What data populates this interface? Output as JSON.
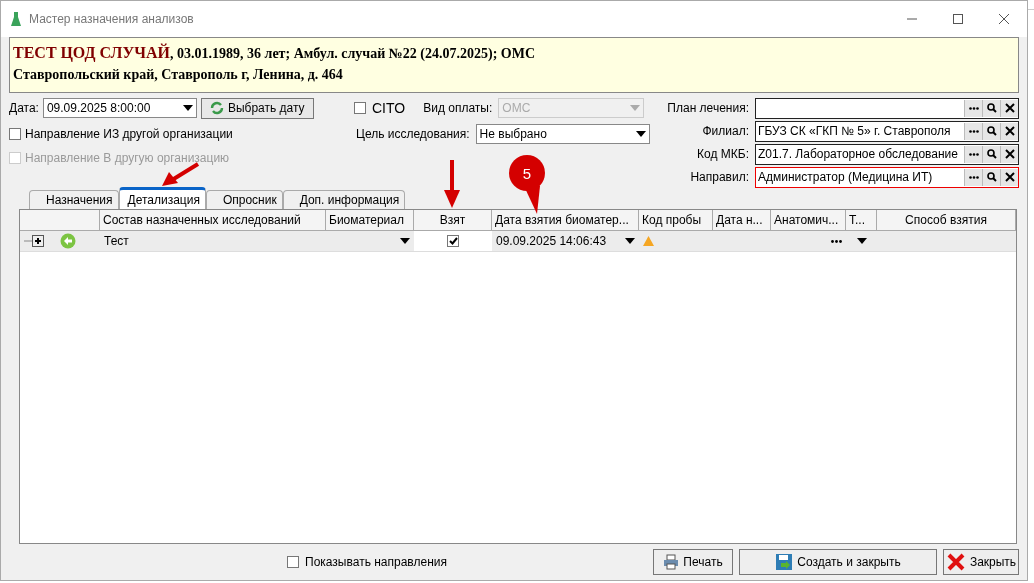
{
  "window": {
    "title": "Мастер назначения анализов"
  },
  "patient": {
    "name": "ТЕСТ ЦОД СЛУЧАЙ",
    "details": ", 03.01.1989, 36 лет; Амбул. случай №22 (24.07.2025); ОМС",
    "address": "Ставропольский край, Ставрополь г, Ленина, д. 464"
  },
  "form": {
    "date": {
      "label": "Дата:",
      "value": "09.09.2025 8:00:00"
    },
    "pick_date_button": "Выбрать дату",
    "cito": {
      "label": "CITO",
      "checked": false
    },
    "payment": {
      "label": "Вид оплаты:",
      "value": "ОМС",
      "disabled": true
    },
    "purpose": {
      "label": "Цель исследования:",
      "value": "Не выбрано",
      "disabled": false
    },
    "from_org": {
      "label": "Направление ИЗ другой организации",
      "checked": false,
      "disabled": false
    },
    "to_org": {
      "label": "Направление В другую организацию",
      "checked": false,
      "disabled": true
    }
  },
  "lookups": [
    {
      "label": "План лечения:",
      "highlighted": false
    },
    {
      "label": "Филиал:",
      "value": "ГБУЗ СК «ГКП № 5» г. Ставрополя",
      "highlighted": false
    },
    {
      "label": "Код МКБ:",
      "value": "Z01.7. Лабораторное обследование",
      "highlighted": false
    },
    {
      "label": "Направил:",
      "value": "Администратор (Медицина ИТ)",
      "highlighted": true
    }
  ],
  "tabs": [
    {
      "label": "Назначения",
      "selected": false
    },
    {
      "label": "Детализация",
      "selected": true
    },
    {
      "label": "Опросник",
      "selected": false
    },
    {
      "label": "Доп. информация",
      "selected": false
    }
  ],
  "table": {
    "columns": [
      "Состав назначенных исследований",
      "Биоматериал",
      "Взят",
      "Дата взятия биоматер...",
      "Код пробы",
      "Дата н...",
      "Анатомич...",
      "Т...",
      "Способ взятия"
    ],
    "rows": [
      {
        "expanded": false,
        "name": "Тест",
        "taken": true,
        "date": "09.09.2025 14:06:43",
        "warning": true
      }
    ]
  },
  "footer": {
    "show_directions": {
      "label": "Показывать направления",
      "checked": false
    },
    "buttons": [
      {
        "label": "Печать",
        "kind": "print"
      },
      {
        "label": "Создать и закрыть",
        "kind": "save"
      },
      {
        "label": "Закрыть",
        "kind": "close"
      }
    ]
  },
  "annotations": {
    "badge": "5"
  }
}
